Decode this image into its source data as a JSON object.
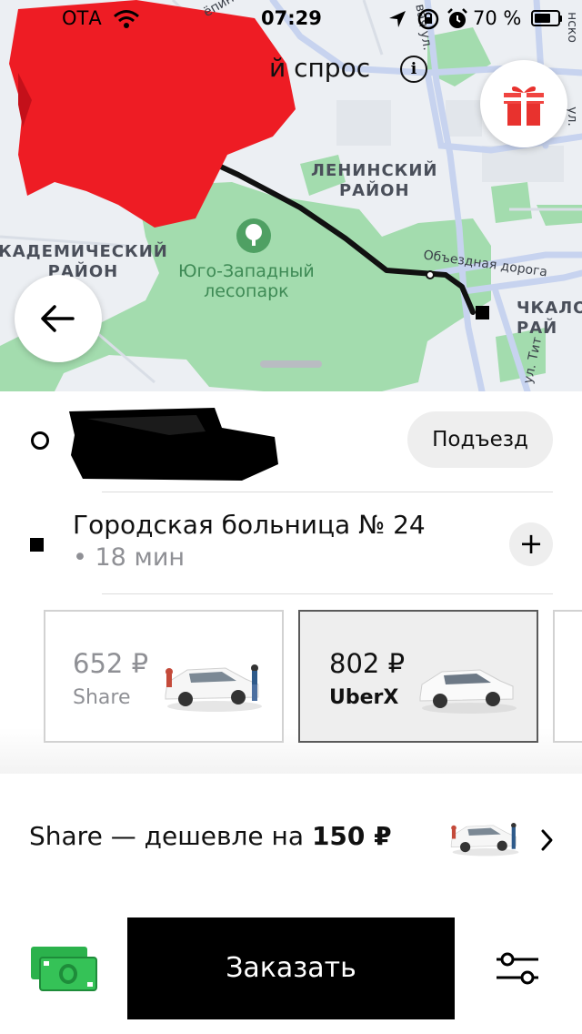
{
  "status_bar": {
    "carrier": "ОТА",
    "time": "07:29",
    "battery_percent": "70 %"
  },
  "map": {
    "surge_text": "й спрос",
    "info_icon": "i",
    "districts": {
      "leninsky": "ЛЕНИНСКИЙ\nРАЙОН",
      "akademichesky": "КАДЕМИЧЕСКИЙ\nРАЙОН",
      "chkalovsky": "ЧКАЛО\nРАЙ"
    },
    "park_name": "Юго-Западный\nлесопарк",
    "streets": {
      "ring_road": "Объездная дорога",
      "repina": "ёпина",
      "street_top": "вая ул.",
      "titova": "ул. Тит",
      "right_top": "нско",
      "right_mid": "ул."
    },
    "icons": [
      "gift-icon",
      "arrow-left-icon",
      "park-tree-icon"
    ]
  },
  "route": {
    "pickup_button": "Подъезд",
    "destination_name": "Городская больница № 24",
    "destination_eta": "• 18 мин",
    "add_stop_icon": "+"
  },
  "tariffs": [
    {
      "price": "652 ₽",
      "name": "Share",
      "selected": false
    },
    {
      "price": "802 ₽",
      "name": "UberX",
      "selected": true
    }
  ],
  "share_promo": {
    "prefix": "Share — дешевле на ",
    "amount": "150 ₽"
  },
  "footer": {
    "order_button": "Заказать",
    "payment_icon": "cash-icon",
    "preferences_icon": "sliders-icon"
  },
  "colors": {
    "map_background": "#eceff3",
    "park_green": "#9fdcab",
    "road": "#c7d3ef",
    "route_line": "#111111",
    "redaction_red": "#ee1c24",
    "cash_green": "#2bb24c",
    "selected_card": "#eeeeee"
  }
}
